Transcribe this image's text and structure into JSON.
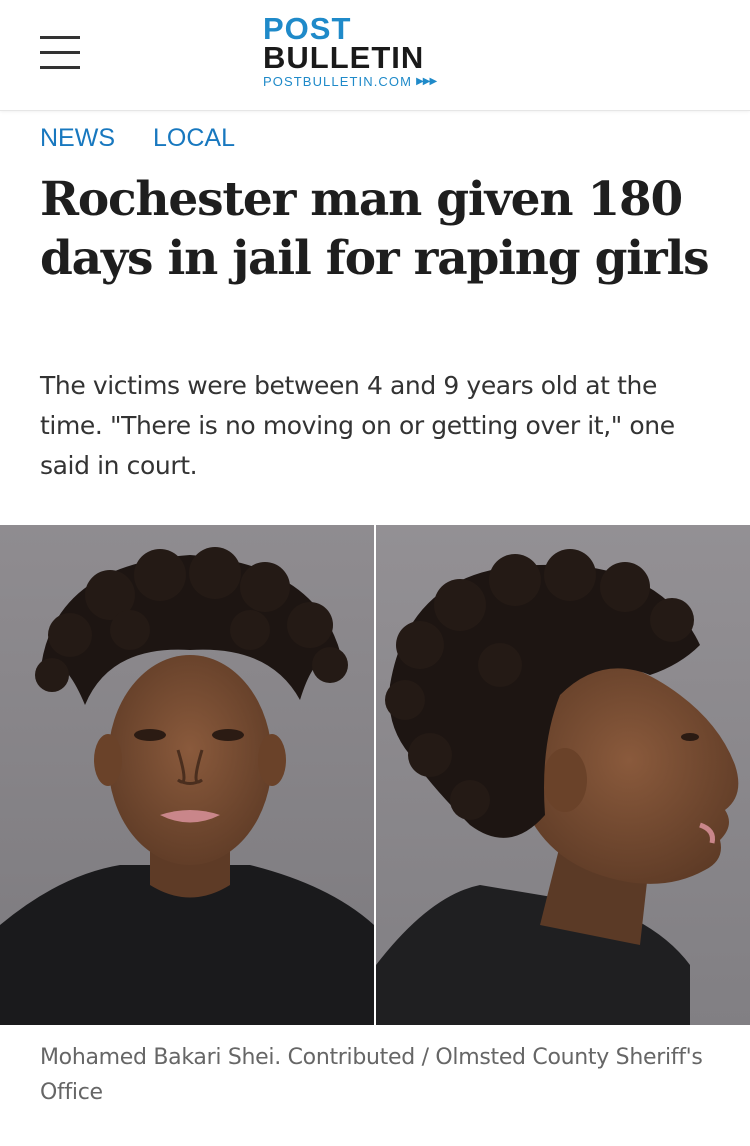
{
  "site": {
    "logo_line1": "POST",
    "logo_line2": "BULLETIN",
    "logo_url": "POSTBULLETIN.COM",
    "brand_color": "#1f8ac9"
  },
  "header": {
    "menu_icon": "hamburger-menu-icon"
  },
  "sections": [
    {
      "label": "NEWS"
    },
    {
      "label": "LOCAL"
    }
  ],
  "article": {
    "headline": "Rochester man given 180 days in jail for raping girls",
    "dek": "The victims were between 4 and 9 years old at the time. \"There is no moving on or getting over it,\" one said in court.",
    "photo_caption": "Mohamed Bakari Shei.  Contributed / Olmsted County Sheriff's Office"
  }
}
